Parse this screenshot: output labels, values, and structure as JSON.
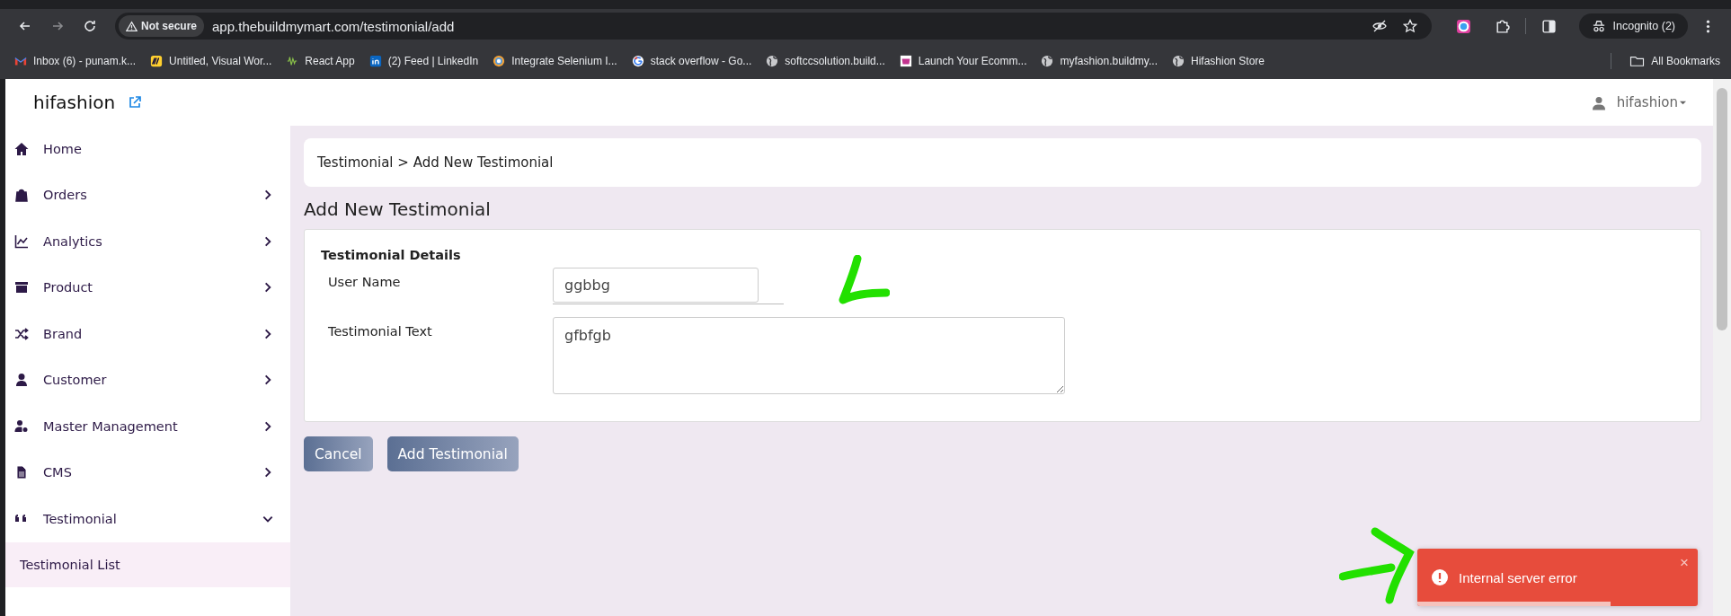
{
  "browser": {
    "security": "Not secure",
    "url": "app.thebuildmymart.com/testimonial/add",
    "profile": "Incognito (2)",
    "bookmarks": [
      {
        "label": "Inbox (6) - punam.k...",
        "kind": "mail"
      },
      {
        "label": "Untitled, Visual Wor...",
        "kind": "board"
      },
      {
        "label": "React App",
        "kind": "wave"
      },
      {
        "label": "(2) Feed | LinkedIn",
        "kind": "in"
      },
      {
        "label": "Integrate Selenium I...",
        "kind": "ring"
      },
      {
        "label": "stack overflow - Go...",
        "kind": "g"
      },
      {
        "label": "softccsolution.build...",
        "kind": "globe"
      },
      {
        "label": "Launch Your Ecomm...",
        "kind": "shop"
      },
      {
        "label": "myfashion.buildmy...",
        "kind": "globe"
      },
      {
        "label": "Hifashion Store",
        "kind": "globe"
      }
    ],
    "all_bookmarks": "All Bookmarks"
  },
  "app": {
    "brand": "hifashion",
    "user": "hifashion"
  },
  "sidebar": {
    "items": [
      {
        "label": "Home",
        "kind": "home"
      },
      {
        "label": "Orders",
        "kind": "bag",
        "expanded": false
      },
      {
        "label": "Analytics",
        "kind": "chart",
        "expanded": false
      },
      {
        "label": "Product",
        "kind": "box",
        "expanded": false
      },
      {
        "label": "Brand",
        "kind": "shuffle",
        "expanded": false
      },
      {
        "label": "Customer",
        "kind": "user",
        "expanded": false
      },
      {
        "label": "Master Management",
        "kind": "usergear",
        "expanded": false
      },
      {
        "label": "CMS",
        "kind": "doc",
        "expanded": false
      },
      {
        "label": "Testimonial",
        "kind": "quote",
        "expanded": true,
        "children": [
          {
            "label": "Testimonial List",
            "selected": true
          }
        ]
      }
    ]
  },
  "breadcrumb": "Testimonial > Add New Testimonial",
  "heading": "Add New Testimonial",
  "form": {
    "section": "Testimonial Details",
    "fields": [
      {
        "label": "User Name",
        "kind": "input",
        "value": "ggbbg"
      },
      {
        "label": "Testimonial Text",
        "kind": "textarea",
        "value": "gfbfgb"
      }
    ],
    "buttons": [
      "Cancel",
      "Add Testimonial"
    ]
  },
  "toast": {
    "message": "Internal server error",
    "close": "×",
    "level": 0.69
  }
}
